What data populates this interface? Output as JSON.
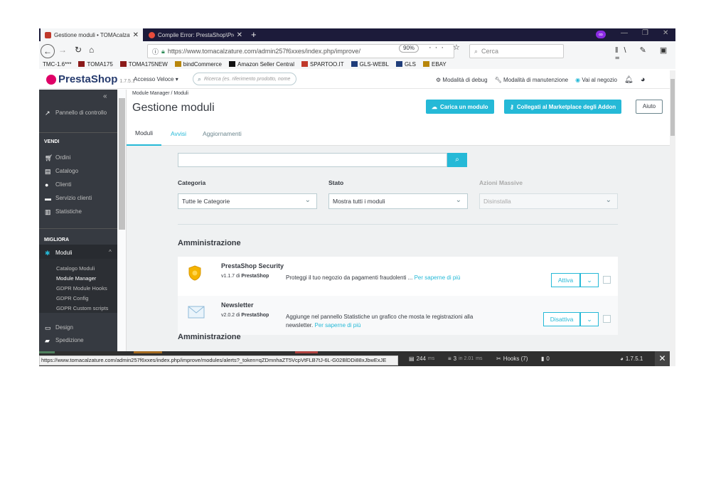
{
  "browser": {
    "tabs": [
      {
        "title": "Gestione moduli • TOMAcalzat",
        "active": true
      },
      {
        "title": "Compile Error: PrestaShop\\Pre",
        "active": false
      }
    ],
    "url": "https://www.tomacalzature.com/admin257f6xxes/index.php/improve/",
    "zoom": "90%",
    "search_placeholder": "Cerca",
    "bookmarks": [
      "TMC-1.6***",
      "TOMA175",
      "TOMA175NEW",
      "bindCommerce",
      "Amazon Seller Central",
      "SPARTOO.IT",
      "GLS-WEBL",
      "GLS",
      "EBAY"
    ],
    "status_url": "https://www.tomacalzature.com/admin257f6xxes/index.php/improve/modules/alerts?_token=qZDmnhaZT5VcpVtFLB7tJ-6L-G02BlDDi88xJbwExJE"
  },
  "header": {
    "logo": "PrestaShop",
    "version": "1.7.5.1",
    "quick_access": "Accesso Veloce",
    "search_placeholder": "Ricerca (es. riferimento prodotto, nome",
    "debug_mode": "Modalità di debug",
    "maintenance_mode": "Modalità di manutenzione",
    "go_to_shop": "Vai al negozio"
  },
  "sidebar": {
    "dashboard": "Pannello di controllo",
    "section_sell": "VENDI",
    "sell_items": [
      "Ordini",
      "Catalogo",
      "Clienti",
      "Servizio clienti",
      "Statistiche"
    ],
    "section_improve": "MIGLIORA",
    "modules": "Moduli",
    "module_subitems": [
      "Catalogo Moduli",
      "Module Manager",
      "GDPR Module Hooks",
      "GDPR Config",
      "GDPR Custom scripts"
    ],
    "design": "Design",
    "shipping": "Spedizione"
  },
  "page": {
    "breadcrumb": "Module Manager  /  Moduli",
    "title": "Gestione moduli",
    "upload_button": "Carica un modulo",
    "marketplace_button": "Collegati al Marketplace degli Addon",
    "help_button": "Aiuto",
    "tabs": [
      "Moduli",
      "Avvisi",
      "Aggiornamenti"
    ],
    "filters": {
      "category_label": "Categoria",
      "category_value": "Tutte le Categorie",
      "status_label": "Stato",
      "status_value": "Mostra tutti i moduli",
      "bulk_label": "Azioni Massive",
      "bulk_value": "Disinstalla"
    },
    "section_title": "Amministrazione",
    "modules": [
      {
        "name": "PrestaShop Security",
        "version": "v1.1.7 di",
        "author": "PrestaShop",
        "desc": "Proteggi il tuo negozio da pagamenti fraudolenti ...",
        "link": "Per saperne di più",
        "action": "Attiva"
      },
      {
        "name": "Newsletter",
        "version": "v2.0.2 di",
        "author": "PrestaShop",
        "desc": "Aggiunge nel pannello Statistiche un grafico che mosta le registrazioni alla newsletter.",
        "link": "Per saperne di più",
        "action": "Disattiva"
      }
    ],
    "next_section": "Amministrazione"
  },
  "debugbar": {
    "load_time": "244",
    "load_unit": "ms",
    "queries": "3",
    "queries_detail": "in 2.01",
    "queries_unit": "ms",
    "hooks": "Hooks (7)",
    "memory": "0",
    "version": "1.7.5.1"
  },
  "colors": {
    "accent": "#25b9d7",
    "sidebar": "#363a41",
    "brand": "#df0067"
  }
}
